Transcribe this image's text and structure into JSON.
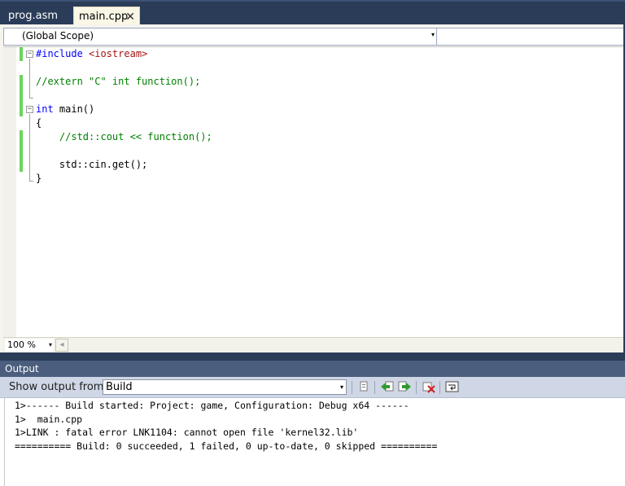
{
  "tabs": [
    {
      "label": "prog.asm",
      "active": false
    },
    {
      "label": "main.cpp",
      "active": true,
      "close_glyph": "✕"
    }
  ],
  "navigation": {
    "scope": "(Global Scope)",
    "member": ""
  },
  "code": {
    "lines": [
      {
        "tokens": [
          {
            "text": "#include ",
            "cls": "kw"
          },
          {
            "text": "<iostream>",
            "cls": "str"
          }
        ]
      },
      {
        "tokens": []
      },
      {
        "tokens": [
          {
            "text": "//extern \"C\" int function();",
            "cls": "cmt"
          }
        ]
      },
      {
        "tokens": []
      },
      {
        "tokens": [
          {
            "text": "int",
            "cls": "kw"
          },
          {
            "text": " main()",
            "cls": ""
          }
        ]
      },
      {
        "tokens": [
          {
            "text": "{",
            "cls": ""
          }
        ]
      },
      {
        "tokens": [
          {
            "text": "    //std::cout << function();",
            "cls": "cmt"
          }
        ]
      },
      {
        "tokens": []
      },
      {
        "tokens": [
          {
            "text": "    std::cin.get();",
            "cls": ""
          }
        ]
      },
      {
        "tokens": [
          {
            "text": "}",
            "cls": ""
          }
        ]
      }
    ]
  },
  "zoom": "100 %",
  "output": {
    "title": "Output",
    "show_label": "Show output from:",
    "source": "Build",
    "lines": [
      "1>------ Build started: Project: game, Configuration: Debug x64 ------",
      "1>  main.cpp",
      "1>LINK : fatal error LNK1104: cannot open file 'kernel32.lib'",
      "========== Build: 0 succeeded, 1 failed, 0 up-to-date, 0 skipped =========="
    ]
  },
  "colors": {
    "keyword": "#0000ff",
    "string": "#a31515",
    "comment": "#008000",
    "change_bar": "#6cd35e",
    "chrome": "#2b3c59"
  },
  "icons": {
    "dropdown": "▾",
    "fold_open": "−",
    "scroll_left": "◂",
    "find_in_output": "find-icon",
    "prev_message": "prev-message-icon",
    "next_message": "next-message-icon",
    "clear_all": "clear-all-icon",
    "word_wrap": "word-wrap-icon"
  }
}
